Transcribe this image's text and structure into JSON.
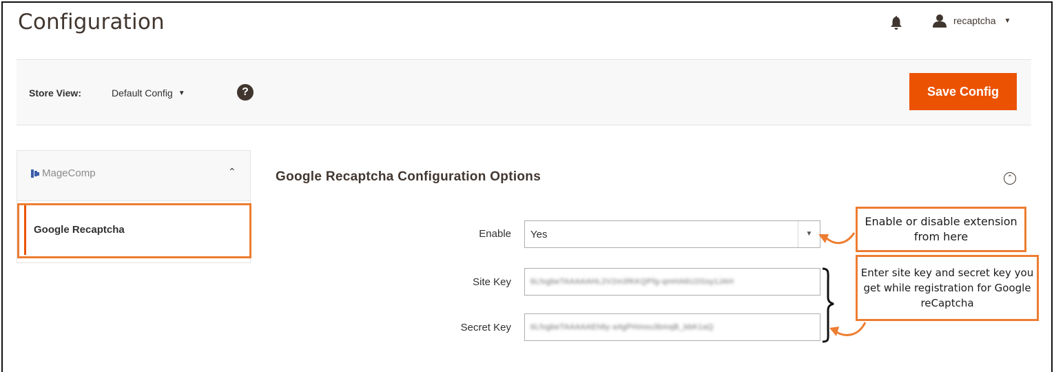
{
  "header": {
    "title": "Configuration",
    "username": "recaptcha"
  },
  "store_bar": {
    "label": "Store View:",
    "selected_scope": "Default Config",
    "help_glyph": "?",
    "save_label": "Save Config"
  },
  "sidebar": {
    "brand": "MageComp",
    "items": [
      {
        "label": "Google Recaptcha",
        "active": true
      }
    ]
  },
  "section": {
    "title": "Google Recaptcha Configuration Options",
    "fields": [
      {
        "label": "Enable",
        "value": "Yes",
        "type": "select"
      },
      {
        "label": "Site Key",
        "value": "6LfxgbeTAAAAAHL2V2m3fKKQPfg-qmHA6U2Gsy1JAH",
        "type": "text",
        "obscured": true
      },
      {
        "label": "Secret Key",
        "value": "6LfxgbeTAAAAAEh8y-a4gPHmou3bmqB_bbK1aQ",
        "type": "text",
        "obscured": true
      }
    ]
  },
  "annotations": [
    {
      "text": "Enable or disable extension from here"
    },
    {
      "text": "Enter site key and secret key you get while registration for Google reCaptcha"
    }
  ],
  "colors": {
    "accent": "#eb5202",
    "highlight": "#ed7d31",
    "brand": "#3a5ea8"
  },
  "icons": {
    "bell": "bell-icon",
    "user": "user-icon",
    "help": "help-icon",
    "chevron_up": "chevron-up-icon",
    "collapse": "collapse-section-icon",
    "select_arrow": "caret-down-icon"
  }
}
